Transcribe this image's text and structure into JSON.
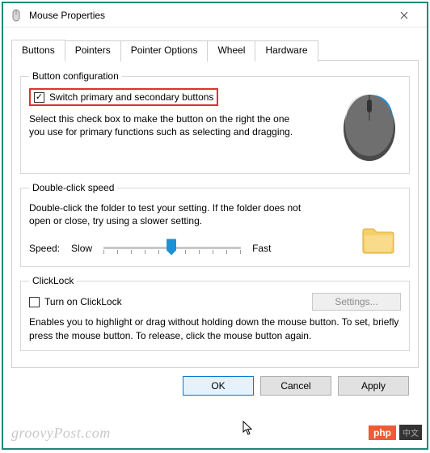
{
  "window": {
    "title": "Mouse Properties",
    "close_tooltip": "Close"
  },
  "tabs": {
    "buttons": "Buttons",
    "pointers": "Pointers",
    "pointer_options": "Pointer Options",
    "wheel": "Wheel",
    "hardware": "Hardware"
  },
  "button_config": {
    "legend": "Button configuration",
    "switch_label": "Switch primary and secondary buttons",
    "switch_checked": true,
    "desc": "Select this check box to make the button on the right the one you use for primary functions such as selecting and dragging."
  },
  "double_click": {
    "legend": "Double-click speed",
    "desc": "Double-click the folder to test your setting. If the folder does not open or close, try using a slower setting.",
    "speed_label": "Speed:",
    "slow_label": "Slow",
    "fast_label": "Fast"
  },
  "clicklock": {
    "legend": "ClickLock",
    "turn_on_label": "Turn on ClickLock",
    "turn_on_checked": false,
    "settings_label": "Settings...",
    "desc": "Enables you to highlight or drag without holding down the mouse button. To set, briefly press the mouse button. To release, click the mouse button again."
  },
  "buttons_row": {
    "ok": "OK",
    "cancel": "Cancel",
    "apply": "Apply"
  },
  "watermark": "groovyPost.com",
  "badge": {
    "php": "php",
    "cn": "中文"
  }
}
